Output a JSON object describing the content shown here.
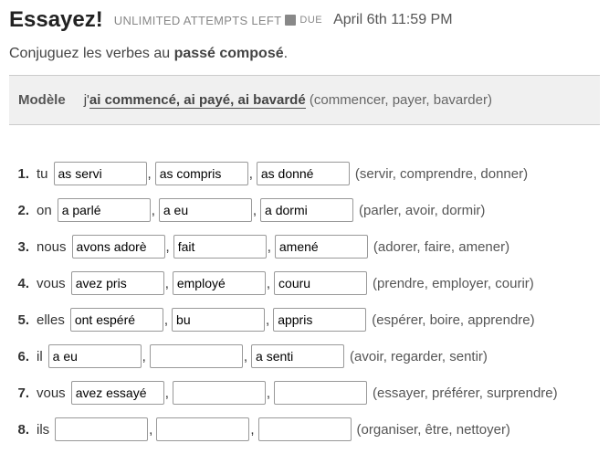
{
  "header": {
    "title": "Essayez!",
    "attempts": "UNLIMITED ATTEMPTS LEFT",
    "due_label": "DUE",
    "due_date": "April 6th 11:59 PM"
  },
  "instructions": {
    "prefix": "Conjuguez les verbes au ",
    "bold": "passé composé",
    "suffix": "."
  },
  "model": {
    "label": "Modèle",
    "prefix": "j'",
    "underlined": "ai commencé, ai payé, ai bavardé",
    "hint": " (commencer, payer, bavarder)"
  },
  "questions": [
    {
      "num": "1.",
      "subject": "tu",
      "a": "as servi",
      "b": "as compris",
      "c": "as donné",
      "hint": "(servir, comprendre, donner)"
    },
    {
      "num": "2.",
      "subject": "on",
      "a": "a parlé",
      "b": "a eu",
      "c": "a dormi",
      "hint": "(parler, avoir, dormir)"
    },
    {
      "num": "3.",
      "subject": "nous",
      "a": "avons adorè",
      "b": "fait",
      "c": "amené",
      "hint": "(adorer, faire, amener)"
    },
    {
      "num": "4.",
      "subject": "vous",
      "a": "avez pris",
      "b": "employé",
      "c": "couru",
      "hint": "(prendre, employer, courir)"
    },
    {
      "num": "5.",
      "subject": "elles",
      "a": "ont espéré",
      "b": "bu",
      "c": "appris",
      "hint": "(espérer, boire, apprendre)"
    },
    {
      "num": "6.",
      "subject": "il",
      "a": "a eu",
      "b": "",
      "c": "a senti",
      "hint": "(avoir, regarder, sentir)"
    },
    {
      "num": "7.",
      "subject": "vous",
      "a": "avez essayé",
      "b": "",
      "c": "",
      "hint": "(essayer, préférer, surprendre)"
    },
    {
      "num": "8.",
      "subject": "ils",
      "a": "",
      "b": "",
      "c": "",
      "hint": "(organiser, être, nettoyer)"
    }
  ]
}
